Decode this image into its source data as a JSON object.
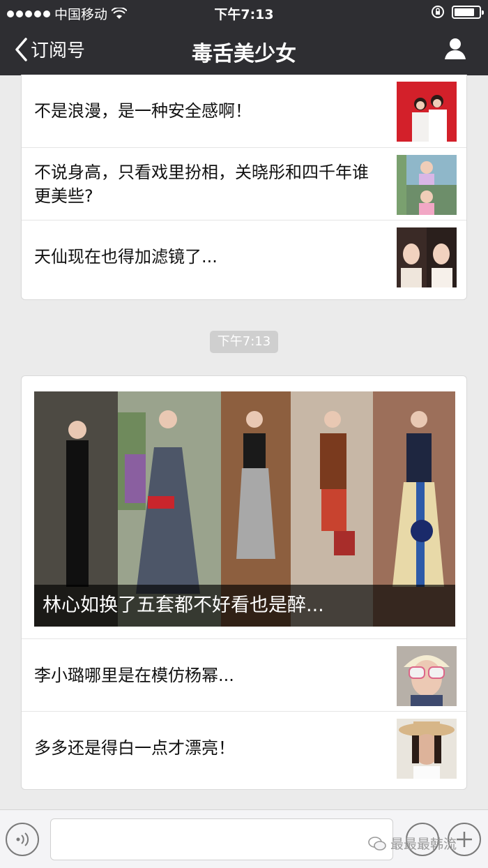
{
  "status_bar": {
    "carrier": "中国移动",
    "time": "下午7:13"
  },
  "nav": {
    "back_label": "订阅号",
    "title": "毒舌美少女"
  },
  "articles_group1": [
    {
      "title": "不是浪漫，是一种安全感啊！",
      "thumb_icon": "wedding-photo-thumbnail"
    },
    {
      "title": "不说身高，只看戏里扮相，关晓彤和四千年谁更美些?",
      "thumb_icon": "drama-costume-thumbnail"
    },
    {
      "title": "天仙现在也得加滤镜了...",
      "thumb_icon": "actress-portrait-thumbnail"
    }
  ],
  "timestamp": "下午7:13",
  "featured": {
    "caption": "林心如换了五套都不好看也是醉...",
    "image_icon": "fashion-collage-image"
  },
  "articles_group2": [
    {
      "title": "李小璐哪里是在模仿杨幂...",
      "thumb_icon": "sunglasses-portrait-thumbnail"
    },
    {
      "title": "多多还是得白一点才漂亮！",
      "thumb_icon": "girl-hat-portrait-thumbnail"
    }
  ],
  "watermark": "最最最韩流",
  "colors": {
    "nav_bg": "#2e2e32",
    "page_bg": "#ebebeb",
    "card_bg": "#ffffff"
  }
}
